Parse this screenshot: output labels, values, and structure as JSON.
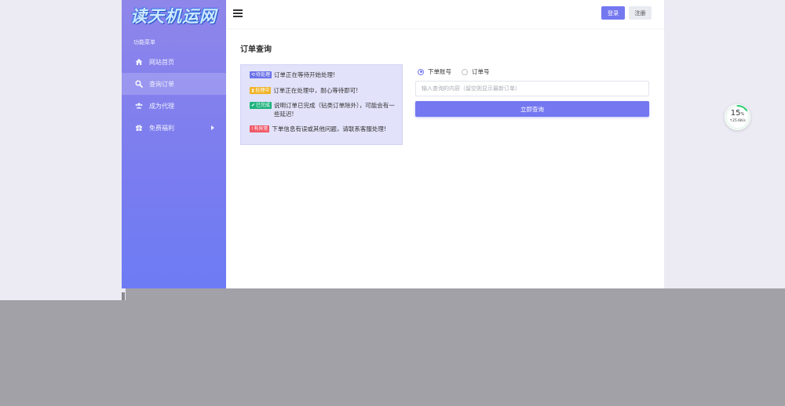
{
  "sidebar": {
    "logo_text": "读天机运网",
    "menu_heading": "功能菜单",
    "items": [
      {
        "label": "网站首页",
        "icon": "home-icon"
      },
      {
        "label": "查询订单",
        "icon": "search-icon",
        "active": true
      },
      {
        "label": "成为代理",
        "icon": "users-icon"
      },
      {
        "label": "免费福利",
        "icon": "gift-icon",
        "has_submenu": true
      }
    ]
  },
  "topbar": {
    "menu_icon": "hamburger-icon",
    "login_label": "登录",
    "register_label": "注册"
  },
  "page": {
    "title": "订单查询"
  },
  "status_info": [
    {
      "badge": "待处理",
      "badge_icon": "refresh-icon",
      "color": "#6b72e8",
      "text": "订单正在等待开始处理!"
    },
    {
      "badge": "处理中",
      "badge_icon": "hourglass-icon",
      "color": "#f0b429",
      "text": "订单正在处理中，耐心等待即可!"
    },
    {
      "badge": "已完成",
      "badge_icon": "check-circle-icon",
      "color": "#1fb37e",
      "text": "说明订单已完成（钻类订单除外），可能会有一些延迟!"
    },
    {
      "badge": "有异常",
      "badge_icon": "alert-circle-icon",
      "color": "#f05866",
      "text": "下单信息有误或其他问题，请联系客服处理!"
    }
  ],
  "query": {
    "radio_options": [
      {
        "label": "下单账号",
        "checked": true
      },
      {
        "label": "订单号",
        "checked": false
      }
    ],
    "input_placeholder": "输入查询的内容（留空则显示最新订单）",
    "input_value": "",
    "submit_label": "立即查询"
  },
  "speed_widget": {
    "percent": "15",
    "percent_unit": "%",
    "rate": "↑25.6K/s",
    "accent": "#2ecc71"
  },
  "colors": {
    "accent": "#7477f0",
    "sidebar_top": "#8f86ea",
    "sidebar_bottom": "#6d7cf4"
  }
}
